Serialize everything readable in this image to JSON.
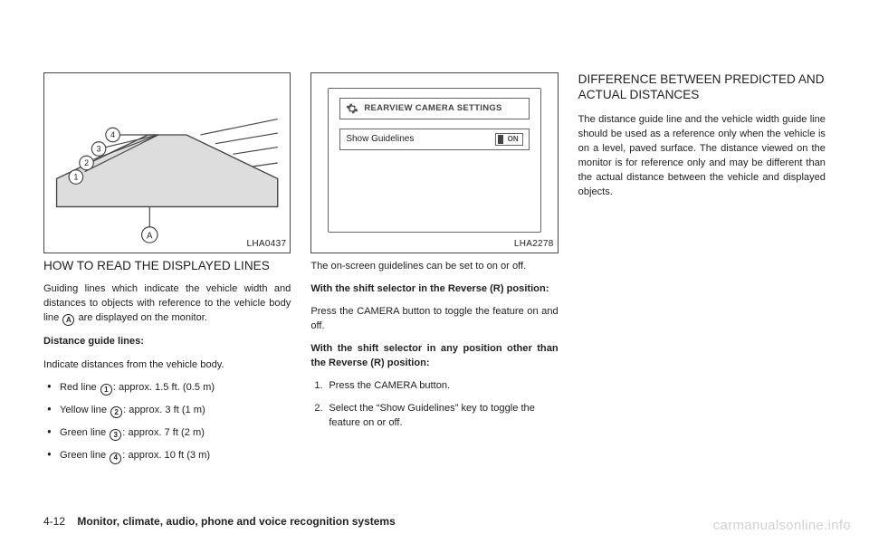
{
  "fig1": {
    "label": "LHA0437"
  },
  "fig2": {
    "label": "LHA2278",
    "title": "REARVIEW CAMERA SETTINGS",
    "row_label": "Show Guidelines",
    "toggle": "ON"
  },
  "col1": {
    "heading": "HOW TO READ THE DISPLAYED LINES",
    "p1a": "Guiding lines which indicate the vehicle width and distances to objects with reference to the vehicle body line ",
    "p1b": " are displayed on the monitor.",
    "sub1": "Distance guide lines:",
    "p2": "Indicate distances from the vehicle body.",
    "li1a": "Red line ",
    "li1b": ": approx. 1.5 ft. (0.5 m)",
    "li2a": "Yellow line ",
    "li2b": ": approx. 3 ft (1 m)",
    "li3a": "Green line ",
    "li3b": ": approx. 7 ft (2 m)",
    "li4a": "Green line ",
    "li4b": ": approx. 10 ft (3 m)",
    "circA": "A",
    "circ1": "1",
    "circ2": "2",
    "circ3": "3",
    "circ4": "4"
  },
  "col2": {
    "p1": "The on-screen guidelines can be set to on or off.",
    "sub1": "With the shift selector in the Reverse (R) position:",
    "p2": "Press the CAMERA button to toggle the feature on and off.",
    "sub2": "With the shift selector in any position other than the Reverse (R) position:",
    "li1": "Press the CAMERA button.",
    "li2": "Select the “Show Guidelines” key to toggle the feature on or off."
  },
  "col3": {
    "heading": "DIFFERENCE BETWEEN PREDICTED AND ACTUAL DISTANCES",
    "p1": "The distance guide line and the vehicle width guide line should be used as a reference only when the vehicle is on a level, paved surface. The distance viewed on the monitor is for reference only and may be different than the actual distance between the vehicle and displayed objects."
  },
  "footer": {
    "page": "4-12",
    "section": "Monitor, climate, audio, phone and voice recognition systems"
  },
  "watermark": "carmanualsonline.info"
}
